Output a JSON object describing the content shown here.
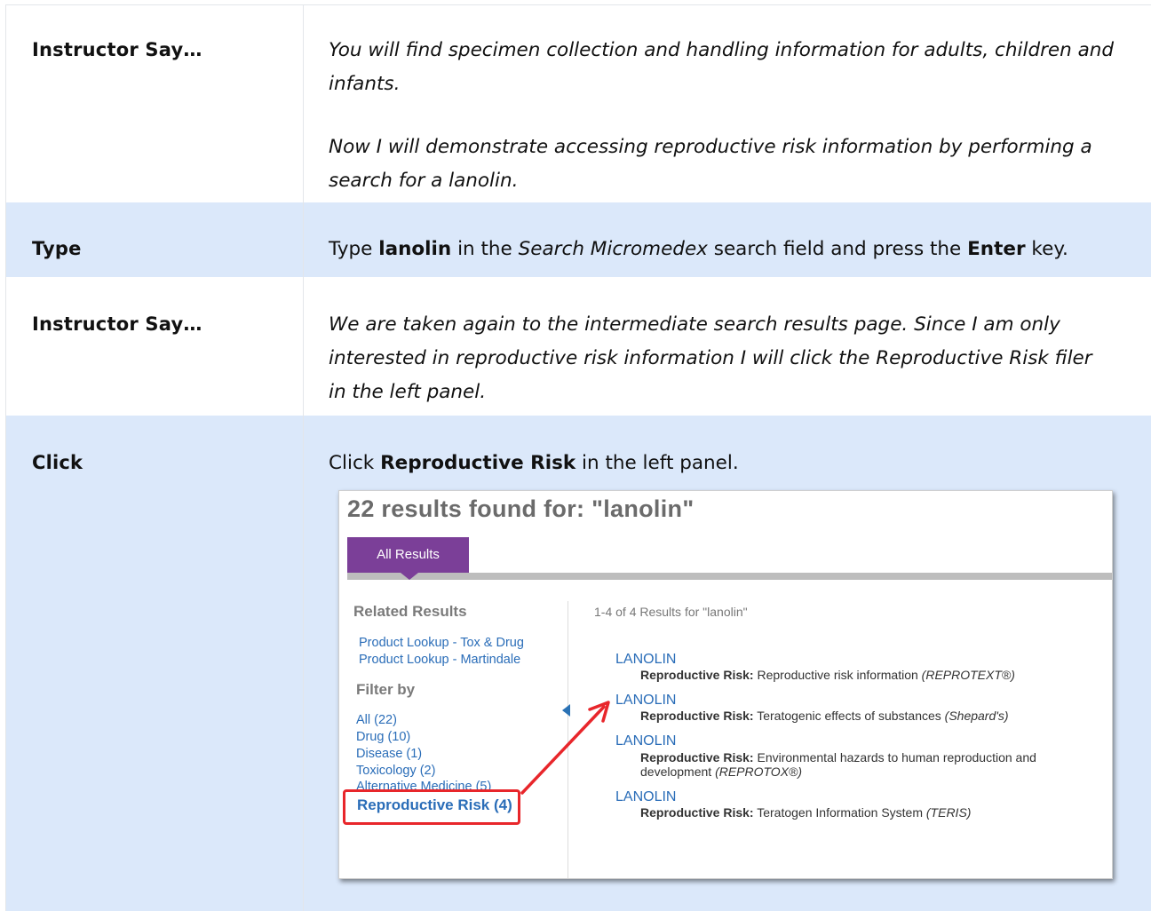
{
  "rows": [
    {
      "label": "Instructor Say…",
      "paragraphs": [
        "You will find specimen collection and handling information for adults, children and infants.",
        "Now I will demonstrate accessing reproductive risk information by performing a search for a lanolin."
      ]
    },
    {
      "label": "Type",
      "parts": [
        "Type ",
        "lanolin",
        " in the ",
        "Search Micromedex",
        " search field and press the ",
        "Enter",
        " key."
      ]
    },
    {
      "label": "Instructor Say…",
      "text": "We are taken again to the intermediate search results page. Since I am only interested in reproductive risk information I will click the Reproductive Risk filer in the left panel."
    },
    {
      "label": "Click",
      "parts": [
        "Click ",
        "Reproductive Risk",
        " in the left panel."
      ]
    }
  ],
  "screenshot": {
    "heading": "22 results found for: \"lanolin\"",
    "tab_label": "All Results",
    "related_title": "Related Results",
    "related_links": [
      "Product Lookup - Tox & Drug",
      "Product Lookup - Martindale"
    ],
    "filter_title": "Filter by",
    "filters": [
      "All (22)",
      "Drug (10)",
      "Disease (1)",
      "Toxicology (2)",
      "Alternative Medicine (5)"
    ],
    "highlighted_filter": "Reproductive Risk (4)",
    "results_header": "1-4 of 4 Results for \"lanolin\"",
    "results": [
      {
        "title": "LANOLIN",
        "category": "Reproductive Risk:",
        "desc": " Reproductive risk information ",
        "source": "(REPROTEXT®)"
      },
      {
        "title": "LANOLIN",
        "category": "Reproductive Risk:",
        "desc": " Teratogenic effects of substances ",
        "source": "(Shepard's)"
      },
      {
        "title": "LANOLIN",
        "category": "Reproductive Risk:",
        "desc": " Environmental hazards to human reproduction and development ",
        "source": "(REPROTOX®)"
      },
      {
        "title": "LANOLIN",
        "category": "Reproductive Risk:",
        "desc": " Teratogen Information System ",
        "source": "(TERIS)"
      }
    ],
    "colors": {
      "tab": "#7b3f98",
      "link": "#2a6db8",
      "annotation": "#e8262b",
      "row_highlight": "#dbe8fa"
    },
    "icons": [
      "collapse-arrow-icon",
      "annotation-arrow-icon"
    ]
  }
}
